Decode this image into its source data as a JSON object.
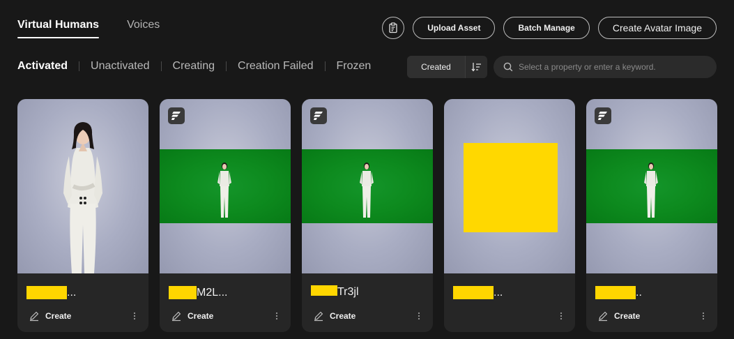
{
  "tabs": [
    {
      "label": "Virtual Humans",
      "active": true
    },
    {
      "label": "Voices",
      "active": false
    }
  ],
  "actions": {
    "copy_icon": "clipboard-copy-icon",
    "upload_asset": "Upload Asset",
    "batch_manage": "Batch Manage",
    "create_avatar_image": "Create Avatar Image"
  },
  "status_filters": [
    {
      "label": "Activated",
      "active": true
    },
    {
      "label": "Unactivated",
      "active": false
    },
    {
      "label": "Creating",
      "active": false
    },
    {
      "label": "Creation Failed",
      "active": false
    },
    {
      "label": "Frozen",
      "active": false
    }
  ],
  "sort": {
    "label": "Created",
    "icon": "sort-order-icon"
  },
  "search": {
    "placeholder": "Select a property or enter a keyword.",
    "value": ""
  },
  "cards": [
    {
      "thumb": "person-portrait",
      "badge": false,
      "name_suffix": "...",
      "create_label": "Create",
      "show_create": true
    },
    {
      "thumb": "person-green-screen",
      "badge": true,
      "name_suffix": "M2L...",
      "create_label": "Create",
      "show_create": true
    },
    {
      "thumb": "person-green-screen",
      "badge": true,
      "name_suffix": "Tr3jl",
      "create_label": "Create",
      "show_create": true
    },
    {
      "thumb": "redacted-square",
      "badge": false,
      "name_suffix": "...",
      "create_label": "",
      "show_create": false
    },
    {
      "thumb": "person-green-screen",
      "badge": true,
      "name_suffix": "..",
      "create_label": "Create",
      "show_create": true
    }
  ],
  "colors": {
    "background": "#181818",
    "card": "#262626",
    "green_screen": "#0d8a1e",
    "redaction": "#ffd600"
  }
}
